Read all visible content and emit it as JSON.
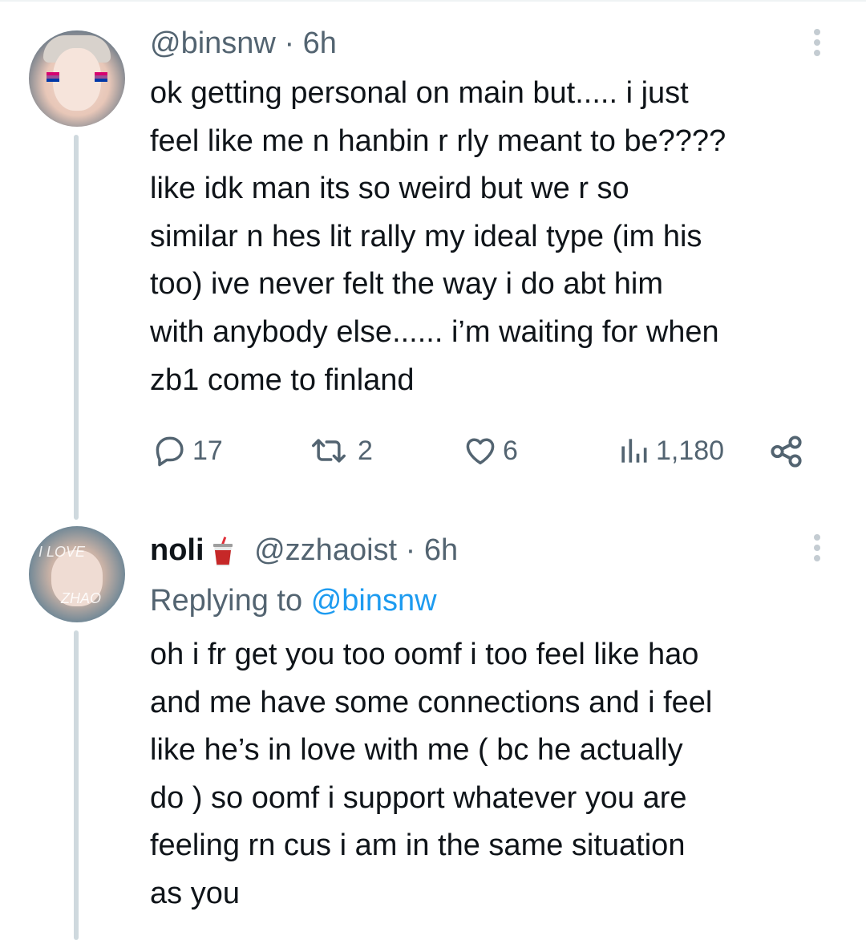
{
  "tweets": [
    {
      "handle": "@binsnw",
      "sep": "·",
      "time": "6h",
      "lines": [
        "ok getting personal on main but..... i just",
        "feel like me n hanbin r rly meant to be????",
        "like idk man its so weird but we r so",
        "similar n hes lit rally my ideal type (im his",
        "too) ive never felt the way i do abt him",
        "with anybody else...... i’m waiting for when",
        "zb1 come to finland"
      ],
      "actions": {
        "replies": "17",
        "retweets": "2",
        "likes": "6",
        "views": "1,180"
      }
    },
    {
      "name": "noli",
      "handle": "@zzhaoist",
      "sep": "·",
      "time": "6h",
      "replying_prefix": "Replying to",
      "replying_to": "@binsnw",
      "avatar_text_top": "I LOVE",
      "avatar_text_bottom": "ZHAO",
      "lines": [
        "oh i fr get you too oomf i too feel like hao",
        "and me have some connections and i feel",
        "like he’s in love with me ( bc he actually",
        "do ) so oomf i support whatever you are",
        "feeling rn cus i am in the same situation",
        "as you"
      ]
    }
  ],
  "icons": {
    "reply": "reply-icon",
    "retweet": "retweet-icon",
    "like": "heart-icon",
    "views": "views-icon",
    "share": "share-icon",
    "more": "more-icon",
    "emoji": "cup-with-straw-emoji"
  },
  "colors": {
    "text": "#0f1419",
    "secondary": "#536471",
    "link": "#1d9bf0",
    "thread_line": "#cfd9de"
  }
}
